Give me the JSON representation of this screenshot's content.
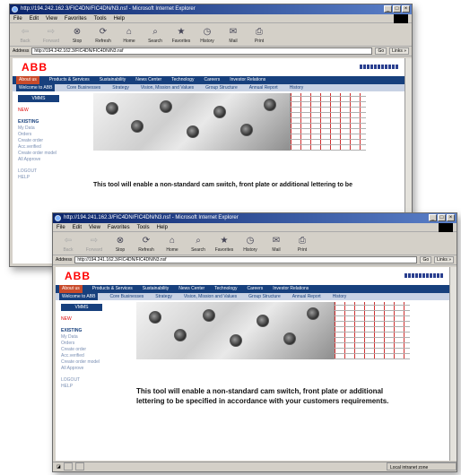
{
  "browser": {
    "title_back": "http://194.242.162.3/FIC4DN/FIC4DN/N3.nsf - Microsoft Internet Explorer",
    "title_front": "http://194.241.162.3/FIC4DN/FIC4DN/N3.nsf - Microsoft Internet Explorer",
    "menu": [
      "File",
      "Edit",
      "View",
      "Favorites",
      "Tools",
      "Help"
    ],
    "toolbar": [
      {
        "label": "Back",
        "icon": "back-arrow-icon",
        "glyph": "⇦",
        "disabled": true
      },
      {
        "label": "Forward",
        "icon": "forward-arrow-icon",
        "glyph": "⇨",
        "disabled": true
      },
      {
        "label": "Stop",
        "icon": "stop-icon",
        "glyph": "⊗",
        "disabled": false
      },
      {
        "label": "Refresh",
        "icon": "refresh-icon",
        "glyph": "⟳",
        "disabled": false
      },
      {
        "label": "Home",
        "icon": "home-icon",
        "glyph": "⌂",
        "disabled": false
      },
      {
        "label": "Search",
        "icon": "search-icon",
        "glyph": "⌕",
        "disabled": false
      },
      {
        "label": "Favorites",
        "icon": "favorites-icon",
        "glyph": "★",
        "disabled": false
      },
      {
        "label": "History",
        "icon": "history-icon",
        "glyph": "◷",
        "disabled": false
      },
      {
        "label": "Mail",
        "icon": "mail-icon",
        "glyph": "✉",
        "disabled": false
      },
      {
        "label": "Print",
        "icon": "print-icon",
        "glyph": "⎙",
        "disabled": false
      }
    ],
    "address_label": "Address",
    "address_back": "http://194.242.162.3/FIC4DN/FIC4DN/N3.nsf",
    "address_front": "http://194.241.162.3/FIC4DN/FIC4DN/N3.nsf",
    "go_label": "Go",
    "links_label": "Links »",
    "status_zone": "Local intranet zone"
  },
  "site": {
    "logo": "ABB",
    "brand_color": "#ff0000",
    "nav_color": "#17407d",
    "top_nav": [
      "About us",
      "Products & Services",
      "Sustainability",
      "News Center",
      "Technology",
      "Careers",
      "Investor Relations"
    ],
    "sub_nav": [
      "Welcome to ABB",
      "Core Businesses",
      "Strategy",
      "Vision, Mission and Values",
      "Group Structure",
      "Annual Report",
      "History"
    ],
    "sidebar": {
      "header": "VMMS",
      "new_label": "NEW",
      "section_label": "EXISTING",
      "items_existing": [
        "My Data",
        "Orders",
        "Create order",
        "Acc.verified",
        "Create order model",
        "All Approve"
      ],
      "items_bottom": [
        "LOGOUT",
        "HELP"
      ]
    },
    "description": "This tool will enable a non-standard cam switch, front plate or additional lettering to be specified in accordance with your customers requirements."
  }
}
